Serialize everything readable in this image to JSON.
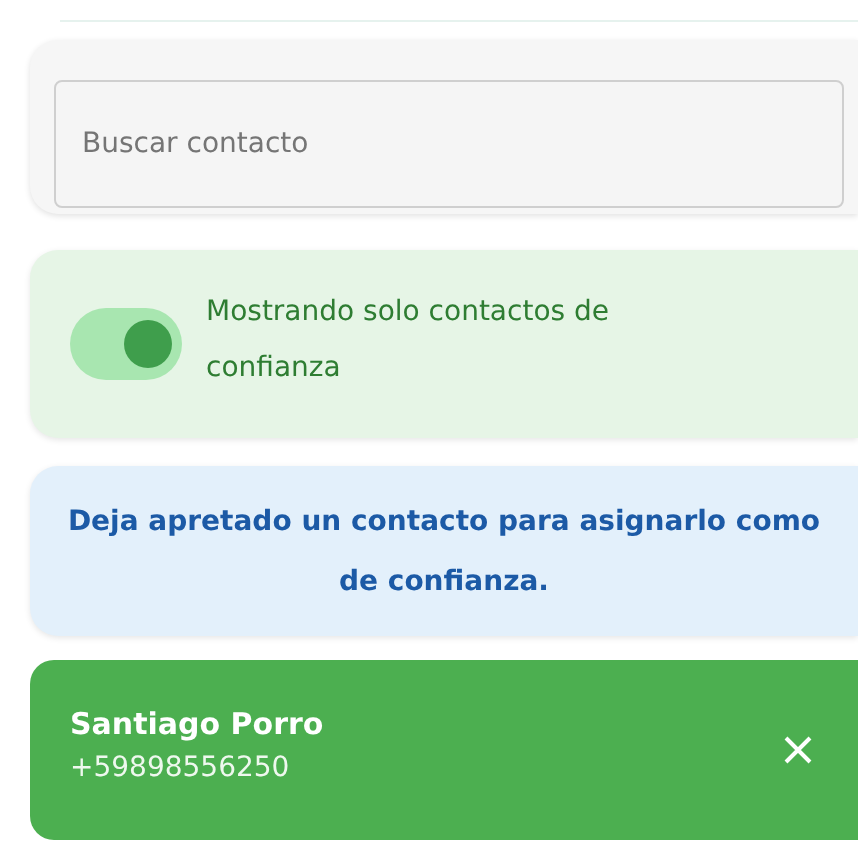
{
  "search": {
    "placeholder": "Buscar contacto"
  },
  "filter": {
    "on": true,
    "label": "Mostrando solo contactos de confianza"
  },
  "hint": "Deja apretado un contacto para asignarlo como de confianza.",
  "contacts": [
    {
      "name": "Santiago Porro",
      "phone": "+59898556250",
      "trusted": true
    }
  ]
}
